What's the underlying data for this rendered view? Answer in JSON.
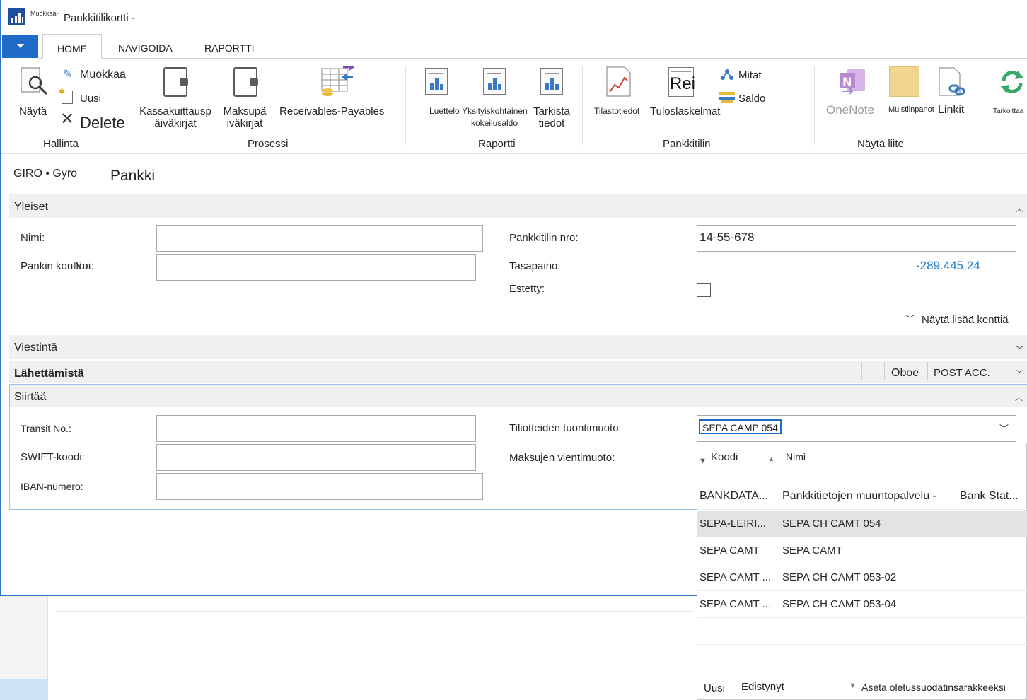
{
  "window": {
    "title_small": "Muokkaa-",
    "title": "Pankkitilikortti -"
  },
  "tabs": [
    {
      "label": "HOME"
    },
    {
      "label": "NAVIGOIDA"
    },
    {
      "label": "RAPORTTI"
    }
  ],
  "ribbon": {
    "hallinta": {
      "label": "Hallinta",
      "nayta": "Näytä",
      "muokkaa": "Muokkaa",
      "uusi": "Uusi",
      "delete": "Delete"
    },
    "prosessi": {
      "label": "Prosessi",
      "kassa_line1": "Kassakuittausp",
      "kassa_line2": "äiväkirjat",
      "maksu_line1": "Maksupä",
      "maksu_line2": "iväkirjat",
      "receivables": "Receivables-Payables"
    },
    "raportti": {
      "label": "Raportti",
      "luettelo": "Luettelo",
      "yks_line1": "Yksityiskohtainen",
      "yks_line2": "kokeilusaldo",
      "tarkista_line1": "Tarkista",
      "tarkista_line2": "tiedot"
    },
    "pankkitilin": {
      "label": "Pankkitilin",
      "tilasto": "Tilastotiedot",
      "tulos_icon_text": "Rei",
      "tulos": "Tuloslaskelmat",
      "mitat": "Mitat",
      "saldo": "Saldo"
    },
    "nayta_liite": {
      "label": "Näytä liite",
      "onenote": "OneNote",
      "muistiinpanot": "Muistiinpanot",
      "linkit": "Linkit"
    },
    "tarkoittaa": "Tarkoittaa"
  },
  "header": {
    "subtitle": "GIRO • Gyro",
    "title": "Pankki"
  },
  "yleiset": {
    "label": "Yleiset",
    "nimi_label": "Nimi:",
    "nimi_value": "",
    "konttori_label_a": "Pankin konttori",
    "konttori_label_b": "No.:",
    "konttori_value": "",
    "tilinro_label": "Pankkitilin nro:",
    "tilinro_value": "14-55-678",
    "tasapaino_label": "Tasapaino:",
    "tasapaino_value": "-289.445,24",
    "estetty_label": "Estetty:",
    "estetty_checked": false,
    "more_fields": "Näytä lisää kenttiä"
  },
  "viestinta": {
    "label": "Viestintä"
  },
  "lahettamista": {
    "label": "Lähettämistä",
    "summary1": "Oboe",
    "summary2": "POST ACC."
  },
  "siirtaa": {
    "label": "Siirtää",
    "transit_label": "Transit No.:",
    "swift_label": "SWIFT-koodi:",
    "iban_label": "IBAN-numero:",
    "tuontimuoto_label": "Tiliotteiden tuontimuoto:",
    "tuontimuoto_value": "SEPA CAMP 054",
    "vientimuoto_label": "Maksujen vientimuoto:"
  },
  "dropdown": {
    "col_koodi": "Koodi",
    "col_nimi": "Nimi",
    "rows": [
      {
        "koodi": "BANKDATA...",
        "nimi": "Pankkitietojen muuntopalvelu -",
        "extra": "Bank Stat..."
      },
      {
        "koodi": "SEPA-LEIRI...",
        "nimi": "SEPA CH CAMT 054",
        "extra": ""
      },
      {
        "koodi": "SEPA CAMT",
        "nimi": "SEPA CAMT",
        "extra": ""
      },
      {
        "koodi": "SEPA CAMT ...",
        "nimi": "SEPA CH CAMT 053-02",
        "extra": ""
      },
      {
        "koodi": "SEPA CAMT ...",
        "nimi": "SEPA CH CAMT 053-04",
        "extra": ""
      }
    ],
    "selected_index": 1,
    "footer_new": "Uusi",
    "footer_advanced": "Edistynyt",
    "footer_filter": "Aseta oletussuodatinsarakkeeksi"
  },
  "colors": {
    "accent": "#1f6bc8",
    "balance": "#1f78c8",
    "row_selected": "#e3e3e3"
  }
}
